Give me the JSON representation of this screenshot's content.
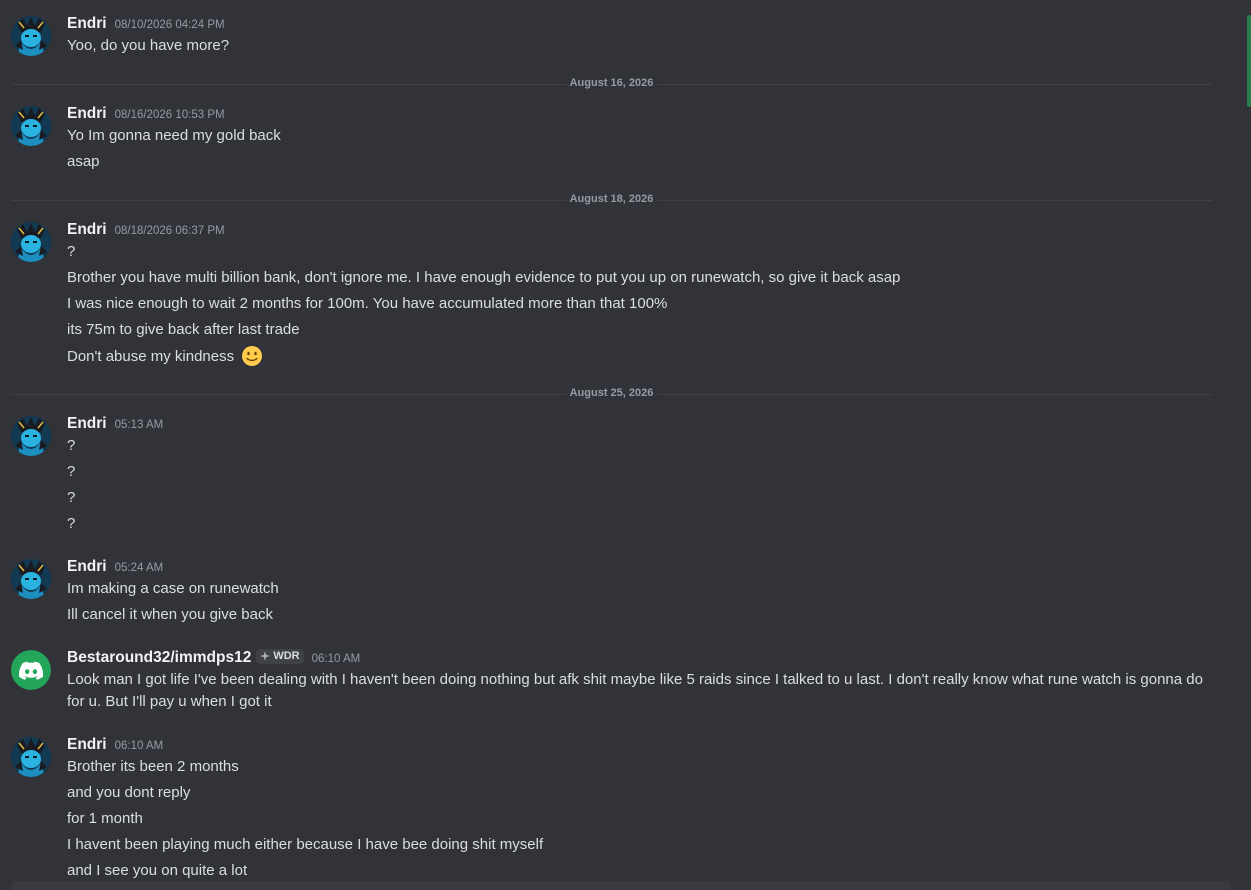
{
  "messages": [
    {
      "author": "Endri",
      "time": "08/10/2026 04:24 PM",
      "lines": [
        "Yoo, do you have more?"
      ]
    },
    {
      "divider": "August 16, 2026"
    },
    {
      "author": "Endri",
      "time": "08/16/2026 10:53 PM",
      "lines": [
        "Yo Im gonna need my gold back",
        "asap"
      ]
    },
    {
      "divider": "August 18, 2026"
    },
    {
      "author": "Endri",
      "time": "08/18/2026 06:37 PM",
      "lines": [
        "?",
        "Brother you have multi billion bank, don't ignore me. I have enough evidence to put you up on runewatch, so give it back asap",
        "I was nice enough to wait 2 months for 100m. You have accumulated more than that 100%",
        "its 75m to give back after last trade",
        "Don't abuse my kindness"
      ]
    },
    {
      "divider": "August 25, 2026"
    },
    {
      "author": "Endri",
      "time": "05:13 AM",
      "lines": [
        "?",
        "?",
        "?",
        "?"
      ]
    },
    {
      "author": "Endri",
      "time": "05:24 AM",
      "lines": [
        "Im making a case on runewatch",
        "Ill cancel it when you give back"
      ]
    },
    {
      "author": "Bestaround32/immdps12",
      "tag": "WDR",
      "time": "06:10 AM",
      "lines": [
        "Look man I got life I've been dealing with I haven't been doing nothing but afk shit maybe like 5 raids since I talked to u last. I don't really know what rune watch is gonna do for u. But I'll pay u when I got it"
      ]
    },
    {
      "author": "Endri",
      "time": "06:10 AM",
      "lines": [
        "Brother its been 2 months",
        "and you dont reply",
        "for 1 month",
        "I havent been playing much either because I have bee doing shit myself",
        "and I see you on quite a lot"
      ]
    }
  ],
  "icons": {
    "endri_avatar": "anime-character-avatar",
    "bestaround_avatar": "discord-logo-avatar",
    "tag_icon": "guild-tag-icon",
    "emoji": "slightly-smiling-face-emoji"
  },
  "colors": {
    "background": "#313338",
    "text": "#dbdee1",
    "username": "#f2f3f5",
    "timestamp": "#949ba4",
    "divider": "#3f4147",
    "discord_green": "#23a55a"
  }
}
